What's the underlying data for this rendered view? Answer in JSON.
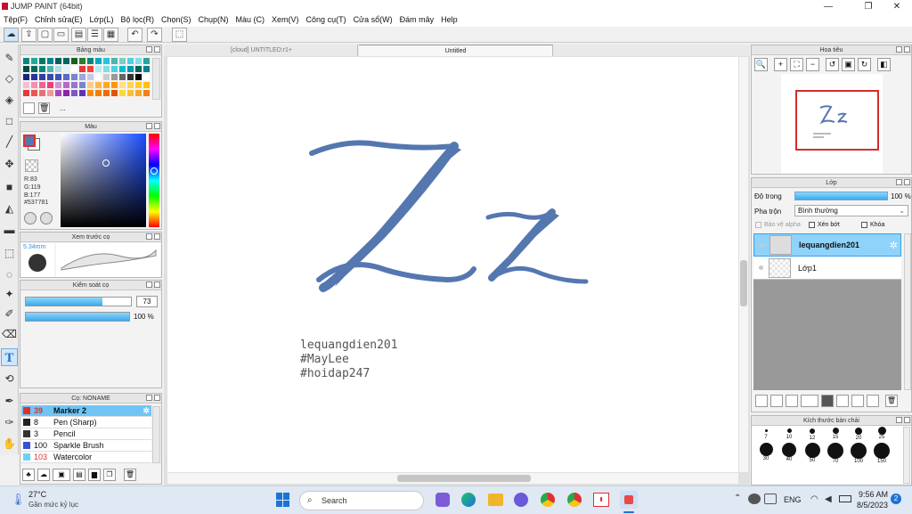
{
  "window": {
    "title": "JUMP PAINT (64bit)",
    "minimize": "—",
    "maximize": "❐",
    "close": "✕"
  },
  "menu": [
    "Tệp(F)",
    "Chỉnh sửa(E)",
    "Lớp(L)",
    "Bộ lọc(R)",
    "Chọn(S)",
    "Chụp(N)",
    "Màu (C)",
    "Xem(V)",
    "Công cụ(T)",
    "Cửa sổ(W)",
    "Đám mây",
    "Help"
  ],
  "palette_panel": {
    "title": "Bảng màu",
    "more": "..."
  },
  "color_panel": {
    "title": "Màu",
    "r": "R:83",
    "g": "G:119",
    "b": "B:177",
    "hex": "#537781"
  },
  "brush_preview": {
    "title": "Xem trước cọ",
    "size": "5.34mm"
  },
  "brush_control": {
    "title": "Kiểm soát cọ",
    "size_value": "73",
    "opacity_value": "100 %",
    "size_fill": 0.73,
    "opacity_fill": 1.0
  },
  "brush_list": {
    "title": "Cọ: NONAME",
    "items": [
      {
        "size": "39",
        "name": "Marker 2",
        "color": "#e0302c",
        "selected": true
      },
      {
        "size": "8",
        "name": "Pen (Sharp)",
        "color": "#222222",
        "selected": false
      },
      {
        "size": "3",
        "name": "Pencil",
        "color": "#333333",
        "selected": false
      },
      {
        "size": "100",
        "name": "Sparkle Brush",
        "color": "#3a4fd8",
        "selected": false
      },
      {
        "size": "103",
        "name": "Watercolor",
        "color": "#69d4f2",
        "selected": false
      }
    ]
  },
  "tabs": [
    {
      "label": "[cloud] UNTITLED:r1+",
      "active": false
    },
    {
      "label": "Untitled",
      "active": true
    }
  ],
  "canvas": {
    "text_lines": [
      "lequangdien201",
      "#MayLee",
      "#hoidap247"
    ],
    "ink_color": "#5577b0"
  },
  "navigator": {
    "title": "Hoa tiêu"
  },
  "layers_panel": {
    "title": "Lớp",
    "opacity_label": "Độ trong",
    "opacity_value": "100 %",
    "blend_label": "Pha trộn",
    "blend_value": "Bình thường",
    "protect_alpha": "Bảo vệ alpha",
    "clipping": "Xén bớt",
    "lock": "Khóa",
    "layers": [
      {
        "name": "lequangdien201",
        "selected": true
      },
      {
        "name": "Lớp1",
        "selected": false
      }
    ]
  },
  "brush_size_panel": {
    "title": "Kích thước bàn chải",
    "sizes": [
      "7",
      "10",
      "12",
      "15",
      "20",
      "25",
      "30",
      "40",
      "50",
      "70",
      "100",
      "150"
    ]
  },
  "taskbar": {
    "weather_temp": "27°C",
    "weather_desc": "Gần mức kỷ lục",
    "search_placeholder": "Search",
    "language": "ENG",
    "time": "9:56 AM",
    "date": "8/5/2023",
    "notification_count": "2"
  },
  "colors": {
    "accent": "#6ec5f5",
    "selected_layer": "#8fd3fb",
    "ink": "#5577b0"
  }
}
